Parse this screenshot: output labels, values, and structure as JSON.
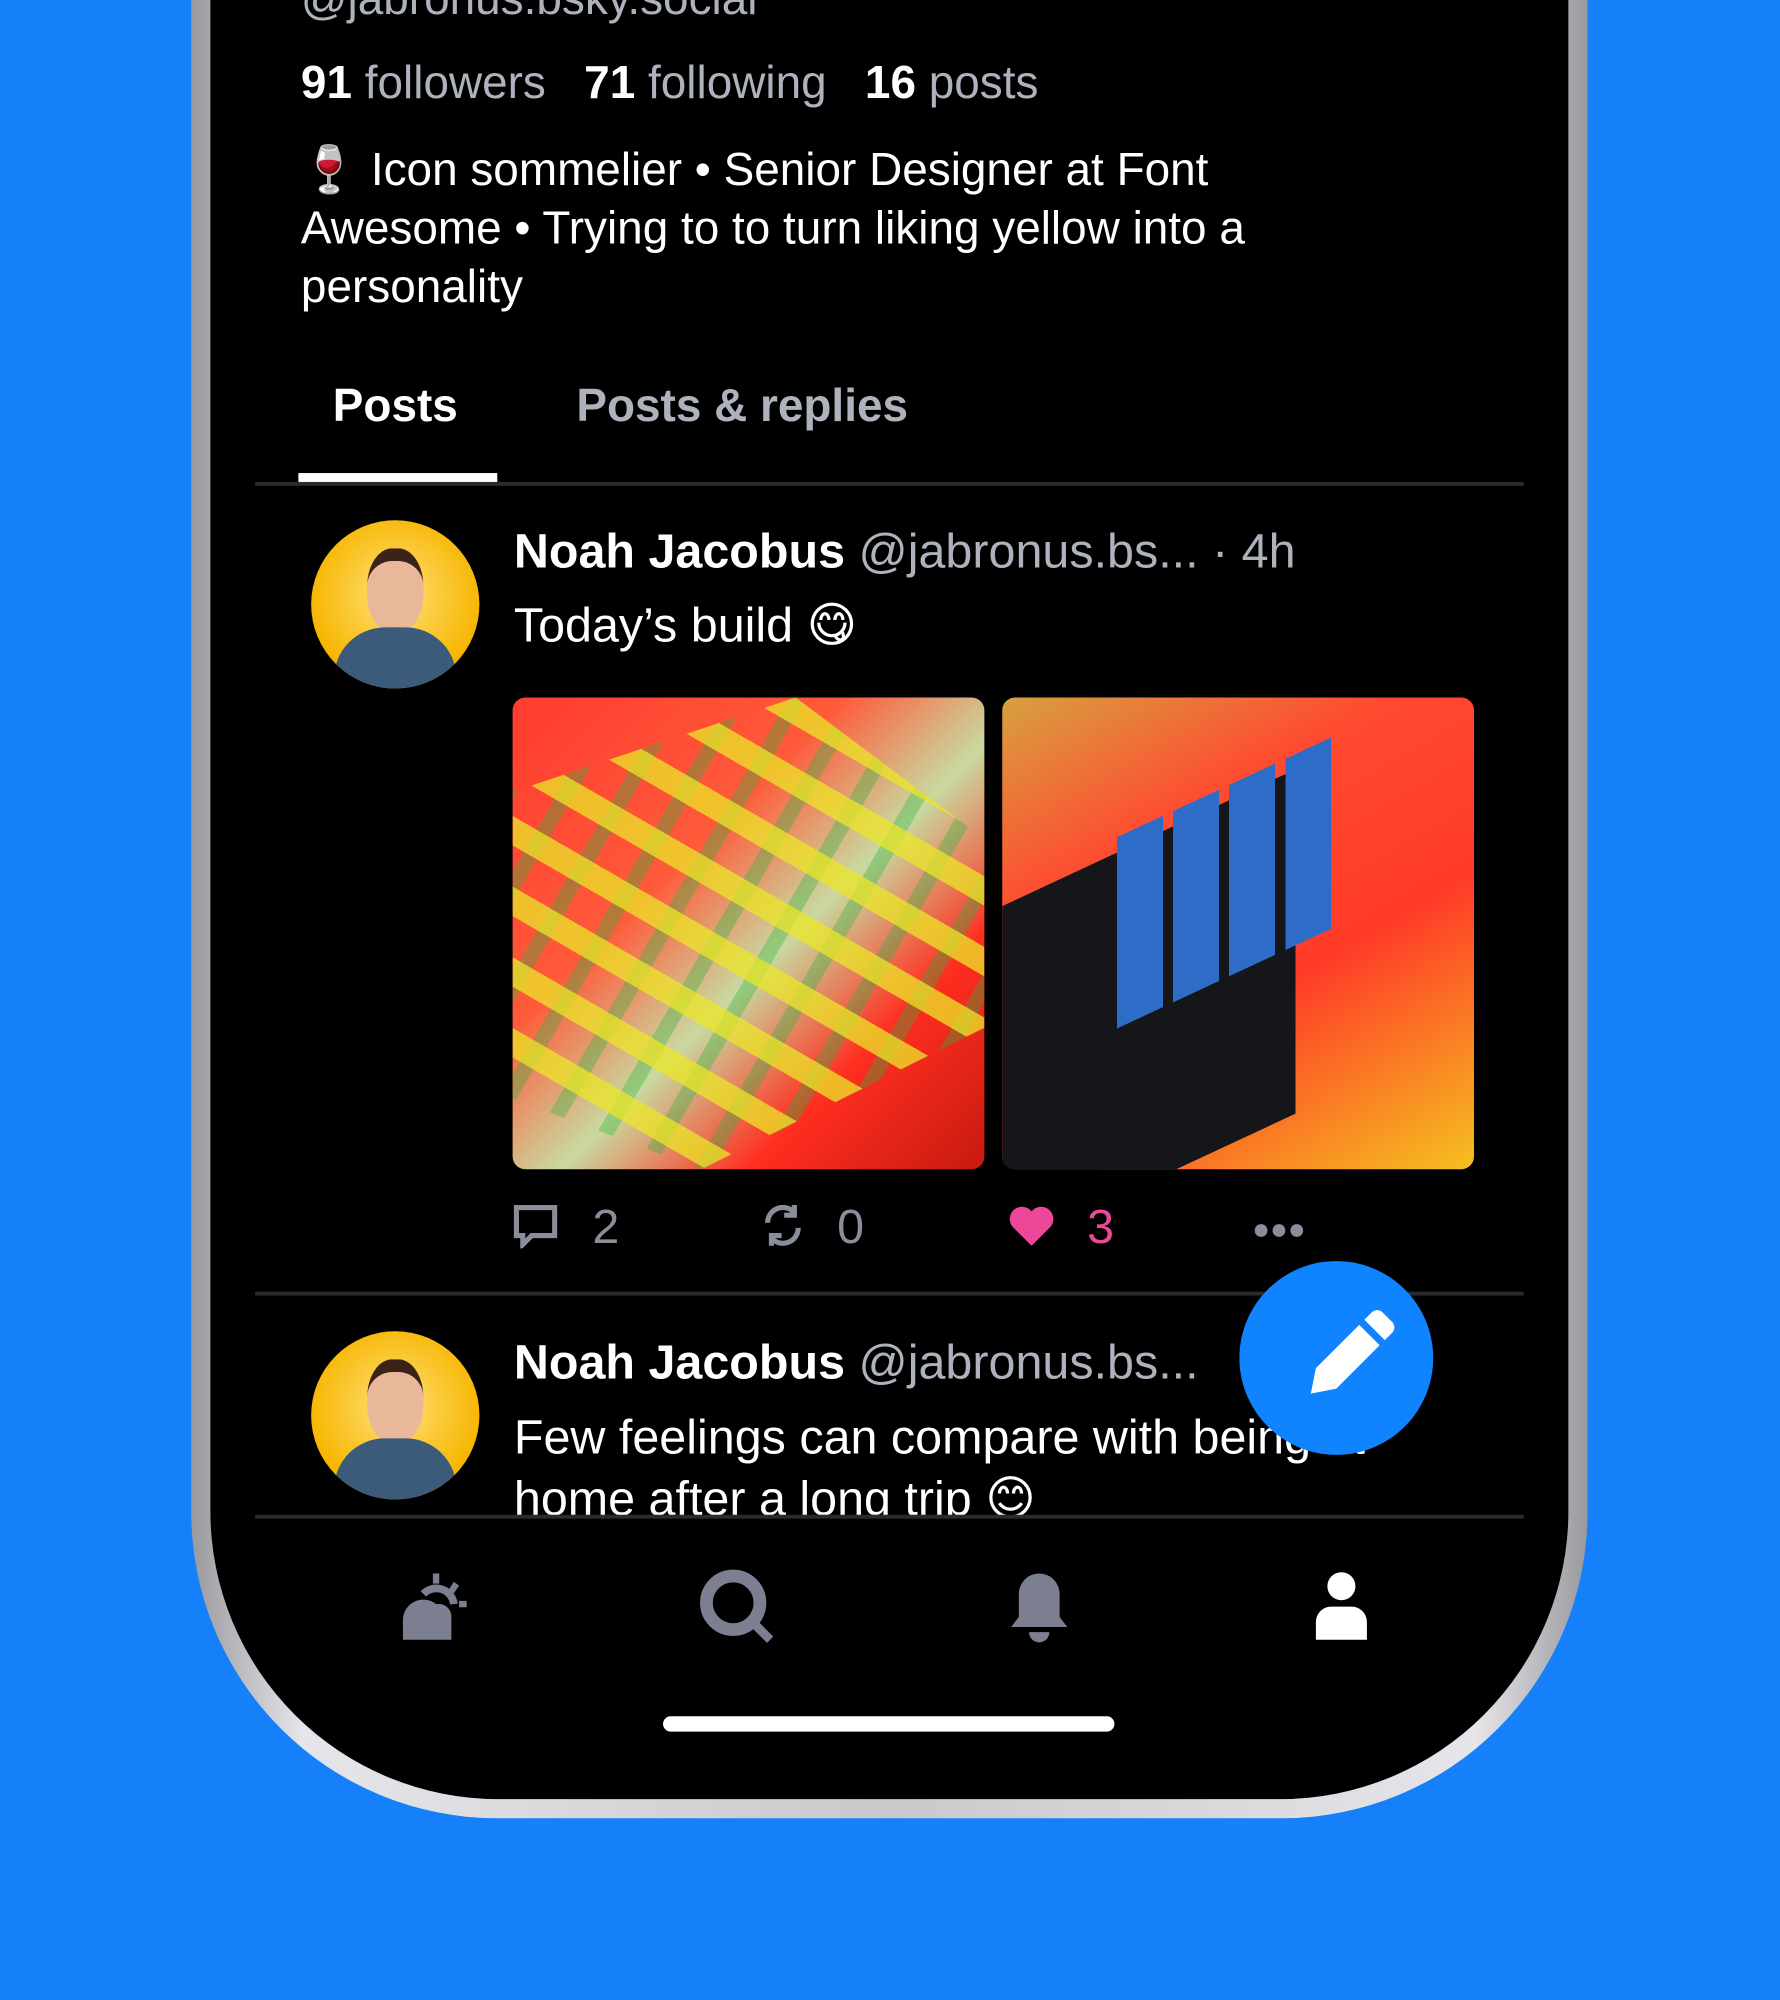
{
  "profile": {
    "handle": "@jabronus.bsky.social",
    "followers_count": "91",
    "followers_label": "followers",
    "following_count": "71",
    "following_label": "following",
    "posts_count": "16",
    "posts_label": "posts",
    "bio_line1": "🍷 Icon sommelier • Senior Designer at Font",
    "bio_line2": "Awesome • Trying to to turn liking yellow into a",
    "bio_line3": "personality"
  },
  "tabs": [
    {
      "label": "Posts",
      "active": true
    },
    {
      "label": "Posts & replies",
      "active": false
    }
  ],
  "posts": [
    {
      "name": "Noah Jacobus",
      "handle": "@jabronus.bs...",
      "time": "· 4h",
      "text": "Today’s build 😋",
      "replies": "2",
      "reposts": "0",
      "likes": "3"
    },
    {
      "name": "Noah Jacobus",
      "handle": "@jabronus.bs...",
      "text_line1": "Few feelings can compare with being at",
      "text_line2": "home after a long trip 😊"
    }
  ],
  "nav": [
    "home-icon",
    "search-icon",
    "notifications-icon",
    "profile-icon"
  ],
  "colors": {
    "background": "#1580f9",
    "accent": "#1083fe",
    "like": "#ec4899"
  }
}
